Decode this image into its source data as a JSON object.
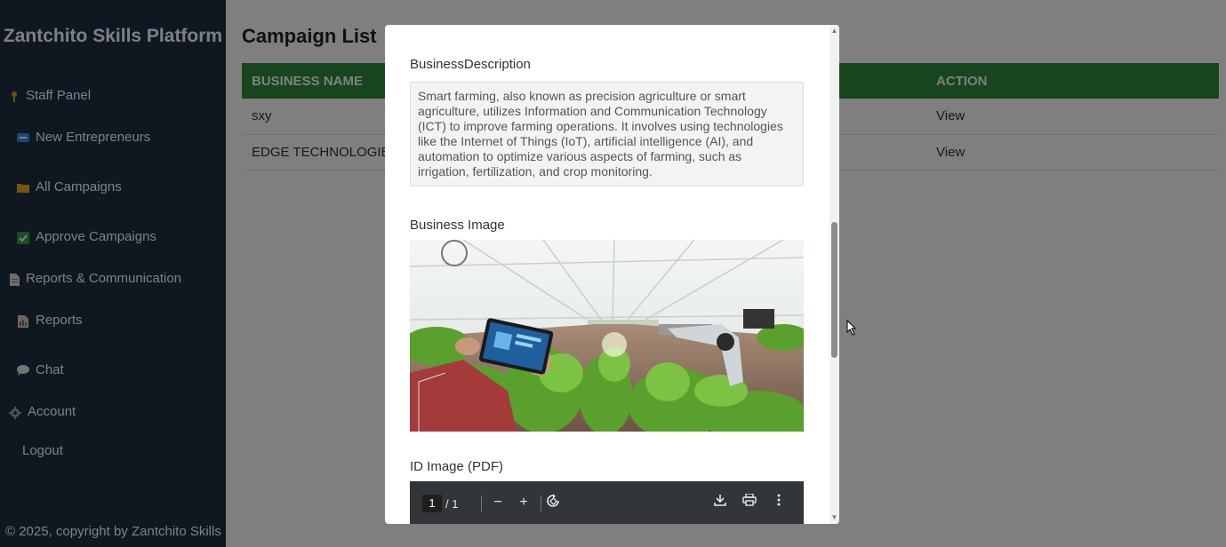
{
  "sidebar": {
    "brand": "Zantchito Skills Platform",
    "items": [
      {
        "label": "Staff Panel",
        "icon": "pin-icon"
      },
      {
        "label": "New Entrepreneurs",
        "icon": "new-badge-icon"
      },
      {
        "label": "All Campaigns",
        "icon": "folder-icon"
      },
      {
        "label": "Approve Campaigns",
        "icon": "check-box-icon"
      },
      {
        "label": "Reports & Communication",
        "icon": "document-icon"
      },
      {
        "label": "Reports",
        "icon": "report-icon"
      },
      {
        "label": "Chat",
        "icon": "speech-bubble-icon"
      },
      {
        "label": "Account",
        "icon": "gear-icon"
      },
      {
        "label": "Logout",
        "icon": ""
      }
    ],
    "copyright": "© 2025, copyright by Zantchito Skills"
  },
  "main": {
    "title": "Campaign List",
    "table": {
      "headers": [
        "BUSINESS NAME",
        "ACTION"
      ],
      "rows": [
        {
          "name": "sxy",
          "action": "View"
        },
        {
          "name": "EDGE TECHNOLOGIE",
          "action": "View"
        }
      ]
    }
  },
  "modal": {
    "description_label": "BusinessDescription",
    "description": "Smart farming, also known as precision agriculture or smart agriculture, utilizes Information and Communication Technology (ICT) to improve farming operations. It involves using technologies like the Internet of Things (IoT), artificial intelligence (AI), and automation to optimize various aspects of farming, such as irrigation, fertilization, and crop monitoring.",
    "image_label": "Business Image",
    "id_label": "ID Image (PDF)",
    "pdf": {
      "page": "1",
      "total": "/ 1",
      "zoom_out": "−",
      "zoom_in": "+"
    }
  },
  "colors": {
    "sidebar_bg": "#1f3142",
    "table_header": "#2e8b3a",
    "overlay": "rgba(0,0,0,0.5)",
    "pdf_toolbar": "#323639"
  }
}
